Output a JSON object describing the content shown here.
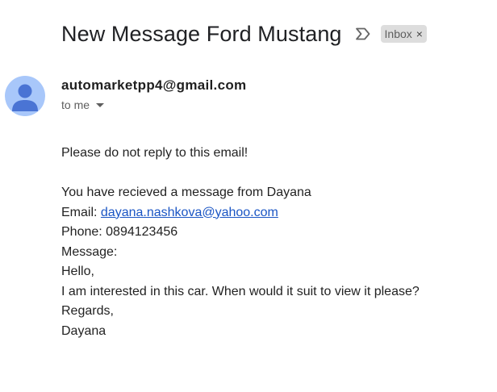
{
  "subject": "New Message Ford Mustang",
  "label": {
    "name": "Inbox",
    "close_glyph": "×",
    "importance_icon": "importance-marker-icon"
  },
  "sender": {
    "email": "automarketpp4@gmail.com",
    "recipient_text": "to me",
    "avatar_icon": "default-person-avatar-icon",
    "avatar_color": "#a8c7fa",
    "avatar_figure_color": "#4a74d4"
  },
  "message": {
    "notice": "Please do not reply to this email!",
    "intro": "You have recieved a message from Dayana",
    "email_label": "Email:",
    "email_link": "dayana.nashkova@yahoo.com",
    "phone_label": "Phone:",
    "phone_value": "0894123456",
    "message_label": "Message:",
    "lines": [
      "Hello,",
      "I am interested in this car. When would it suit to view it please?",
      "Regards,",
      "Dayana"
    ]
  },
  "colors": {
    "link": "#1a55c4",
    "chip_bg": "#dddddd"
  }
}
